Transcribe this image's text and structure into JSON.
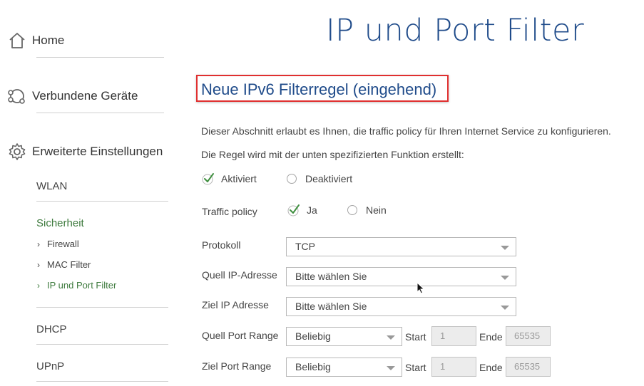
{
  "sidebar": {
    "home": "Home",
    "devices": "Verbundene Geräte",
    "advanced": "Erweiterte Einstellungen",
    "wlan": "WLAN",
    "security": "Sicherheit",
    "firewall": "Firewall",
    "mac_filter": "MAC Filter",
    "ip_port_filter": "IP und Port Filter",
    "dhcp": "DHCP",
    "upnp": "UPnP"
  },
  "page_title": "IP und Port Filter",
  "section_title": "Neue IPv6 Filterregel (eingehend)",
  "description": "Dieser Abschnitt erlaubt es Ihnen, die traffic policy für Ihren Internet Service zu konfigurieren.",
  "rule_note": "Die Regel wird mit der unten spezifizierten Funktion erstellt:",
  "status": {
    "enabled": "Aktiviert",
    "disabled": "Deaktiviert",
    "selected": "enabled"
  },
  "traffic_policy": {
    "label": "Traffic policy",
    "yes": "Ja",
    "no": "Nein",
    "selected": "yes"
  },
  "form": {
    "protocol_label": "Protokoll",
    "protocol_value": "TCP",
    "source_ip_label": "Quell IP-Adresse",
    "source_ip_value": "Bitte wählen Sie",
    "dest_ip_label": "Ziel IP Adresse",
    "dest_ip_value": "Bitte wählen Sie",
    "source_port_label": "Quell Port Range",
    "source_port_value": "Beliebig",
    "dest_port_label": "Ziel Port Range",
    "dest_port_value": "Beliebig",
    "start_label": "Start",
    "end_label": "Ende",
    "start_value": "1",
    "end_value": "65535"
  },
  "colors": {
    "accent": "#1f4b8a",
    "active": "#3d7a3d",
    "highlight": "#e03030",
    "check": "#3f8f3f"
  }
}
